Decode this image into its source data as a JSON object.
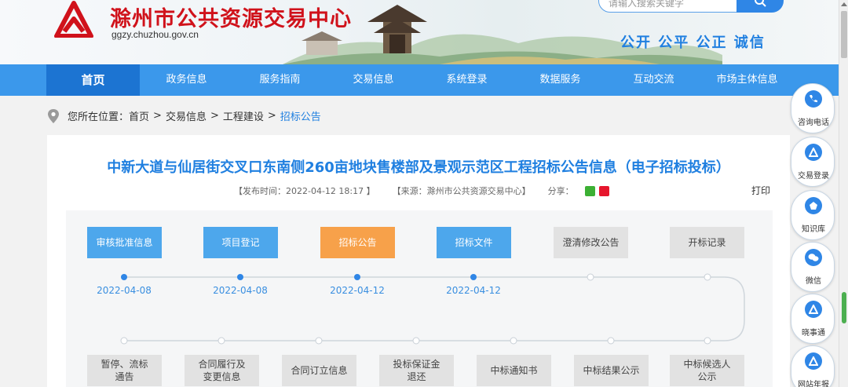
{
  "header": {
    "site_title": "滁州市公共资源交易中心",
    "site_url": "ggzy.chuzhou.gov.cn",
    "search_placeholder": "请输入搜索关键字",
    "slogan": "公开 公平 公正 诚信"
  },
  "nav": {
    "items": [
      {
        "label": "首页",
        "active": true
      },
      {
        "label": "政务信息"
      },
      {
        "label": "服务指南"
      },
      {
        "label": "交易信息"
      },
      {
        "label": "系统登录"
      },
      {
        "label": "数据服务"
      },
      {
        "label": "互动交流"
      },
      {
        "label": "市场主体信息"
      }
    ]
  },
  "breadcrumb": {
    "prefix": "您所在位置：",
    "items": [
      "首页",
      "交易信息",
      "工程建设"
    ],
    "current": "招标公告",
    "separator": ">"
  },
  "article": {
    "title": "中新大道与仙居街交叉口东南侧260亩地块售楼部及景观示范区工程招标公告信息（电子招标投标）",
    "publish_time": "【发布时间：2022-04-12 18:17 】",
    "source": "【来源：滁州市公共资源交易中心】",
    "share_label": "分享：",
    "print_label": "打印"
  },
  "flow": {
    "top_steps": [
      {
        "label": "审核批准信息",
        "style": "blue",
        "date": "2022-04-08"
      },
      {
        "label": "项目登记",
        "style": "blue",
        "date": "2022-04-08"
      },
      {
        "label": "招标公告",
        "style": "orange",
        "date": "2022-04-12"
      },
      {
        "label": "招标文件",
        "style": "blue",
        "date": "2022-04-12"
      },
      {
        "label": "澄清修改公告",
        "style": "gray",
        "date": ""
      },
      {
        "label": "开标记录",
        "style": "gray",
        "date": ""
      }
    ],
    "bottom_steps": [
      {
        "label": "暂停、流标\n通告"
      },
      {
        "label": "合同履行及\n变更信息"
      },
      {
        "label": "合同订立信息"
      },
      {
        "label": "投标保证金\n退还"
      },
      {
        "label": "中标通知书"
      },
      {
        "label": "中标结果公示"
      },
      {
        "label": "中标候选人\n公示"
      }
    ]
  },
  "float_bar": {
    "items": [
      {
        "label": "咨询电话",
        "icon": "phone-icon"
      },
      {
        "label": "交易登录",
        "icon": "login-icon"
      },
      {
        "label": "知识库",
        "icon": "knowledge-icon"
      },
      {
        "label": "微信",
        "icon": "wechat-icon"
      },
      {
        "label": "晓事通",
        "icon": "xiaoshitong-icon"
      },
      {
        "label": "网站年报",
        "icon": "report-icon"
      }
    ]
  },
  "colors": {
    "nav_bg": "#3b98eb",
    "nav_active": "#1c74d2",
    "brand_red": "#d0121b",
    "title_blue": "#1f7fe0",
    "step_blue": "#4da7ec",
    "step_orange": "#f7a14a",
    "step_gray": "#e2e2e2"
  }
}
